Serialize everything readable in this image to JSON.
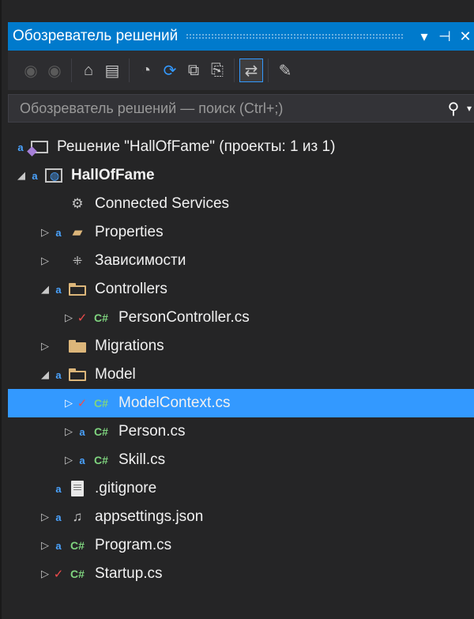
{
  "window": {
    "title": "Обозреватель решений",
    "dropdown_glyph": "▾",
    "pin_glyph": "⊣",
    "close_glyph": "✕"
  },
  "toolbar": {
    "items": [
      {
        "name": "back-icon",
        "glyph": "◉",
        "enabled": false
      },
      {
        "name": "forward-icon",
        "glyph": "◉",
        "enabled": false
      },
      {
        "name": "home-icon",
        "glyph": "⌂",
        "enabled": true
      },
      {
        "name": "switch-views-icon",
        "glyph": "▤",
        "enabled": true
      },
      {
        "name": "pending-changes-icon",
        "glyph": "◔",
        "enabled": true
      },
      {
        "name": "sync-icon",
        "glyph": "⟳",
        "enabled": true
      },
      {
        "name": "collapse-all-icon",
        "glyph": "⧉",
        "enabled": true
      },
      {
        "name": "show-all-files-icon",
        "glyph": "⎘",
        "enabled": true
      },
      {
        "name": "sync-active-document-icon",
        "glyph": "⇄",
        "enabled": true
      },
      {
        "name": "properties-icon",
        "glyph": "✎",
        "enabled": true
      }
    ]
  },
  "search": {
    "placeholder": "Обозреватель решений — поиск (Ctrl+;)",
    "search_glyph": "⚲"
  },
  "tree": [
    {
      "label": "Решение \"HallOfFame\" (проекты: 1 из 1)",
      "icon": "solution",
      "depth": 0,
      "expander": "",
      "status": "lock",
      "bold": false,
      "selected": false
    },
    {
      "label": "HallOfFame",
      "icon": "project",
      "depth": 0,
      "expander": "◢",
      "status": "lock",
      "bold": true,
      "selected": false
    },
    {
      "label": "Connected Services",
      "icon": "connected",
      "depth": 1,
      "expander": "",
      "status": "",
      "bold": false,
      "selected": false
    },
    {
      "label": "Properties",
      "icon": "properties",
      "depth": 1,
      "expander": "▷",
      "status": "lock",
      "bold": false,
      "selected": false
    },
    {
      "label": "Зависимости",
      "icon": "dependencies",
      "depth": 1,
      "expander": "▷",
      "status": "",
      "bold": false,
      "selected": false
    },
    {
      "label": "Controllers",
      "icon": "folder-open",
      "depth": 1,
      "expander": "◢",
      "status": "lock",
      "bold": false,
      "selected": false
    },
    {
      "label": "PersonController.cs",
      "icon": "cs",
      "depth": 2,
      "expander": "▷",
      "status": "check",
      "bold": false,
      "selected": false
    },
    {
      "label": "Migrations",
      "icon": "folder",
      "depth": 1,
      "expander": "▷",
      "status": "",
      "bold": false,
      "selected": false
    },
    {
      "label": "Model",
      "icon": "folder-open",
      "depth": 1,
      "expander": "◢",
      "status": "lock",
      "bold": false,
      "selected": false
    },
    {
      "label": "ModelContext.cs",
      "icon": "cs",
      "depth": 2,
      "expander": "▷",
      "status": "check",
      "bold": false,
      "selected": true
    },
    {
      "label": "Person.cs",
      "icon": "cs",
      "depth": 2,
      "expander": "▷",
      "status": "lock",
      "bold": false,
      "selected": false
    },
    {
      "label": "Skill.cs",
      "icon": "cs",
      "depth": 2,
      "expander": "▷",
      "status": "lock",
      "bold": false,
      "selected": false
    },
    {
      "label": ".gitignore",
      "icon": "doc",
      "depth": 1,
      "expander": "",
      "status": "lock",
      "bold": false,
      "selected": false
    },
    {
      "label": "appsettings.json",
      "icon": "json",
      "depth": 1,
      "expander": "▷",
      "status": "lock",
      "bold": false,
      "selected": false
    },
    {
      "label": "Program.cs",
      "icon": "cs",
      "depth": 1,
      "expander": "▷",
      "status": "lock",
      "bold": false,
      "selected": false
    },
    {
      "label": "Startup.cs",
      "icon": "cs",
      "depth": 1,
      "expander": "▷",
      "status": "check",
      "bold": false,
      "selected": false
    }
  ],
  "colors": {
    "accent": "#007acc",
    "selection": "#3399ff",
    "background": "#252526",
    "lock": "#4aa3ff",
    "check": "#f14c4c",
    "csharp": "#7fd47f",
    "folder": "#dcb67a"
  }
}
